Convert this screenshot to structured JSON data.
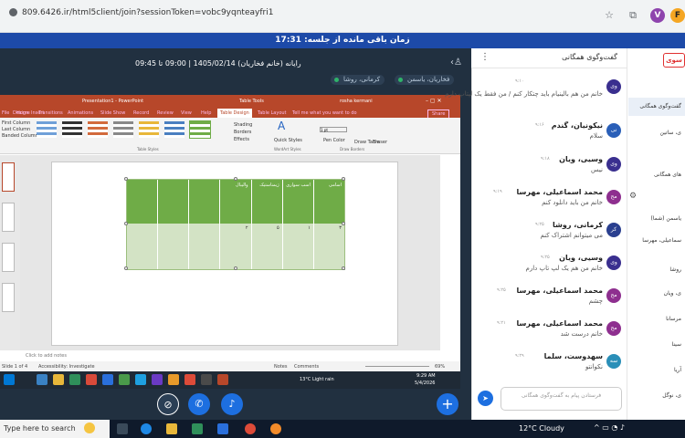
{
  "browser": {
    "url": "809.6426.ir/html5client/join?sessionToken=vobc9yqnteayfri1",
    "avatar_letter": "V"
  },
  "session": {
    "timer_text": "زمان باقی مانده از جلسه: 17:31"
  },
  "stage": {
    "title": "رایانه (خانم فخاریان) 1405/02/14 | 09:00 تا 09:45",
    "presenters": [
      "فخاریان، یاسمن",
      "کرمانی، روشا"
    ]
  },
  "powerpoint": {
    "window_title": "Presentation1 - PowerPoint",
    "context_tab": "Table Tools",
    "user": "rosha kermani",
    "tabs": [
      "File",
      "Home",
      "Insert",
      "Design",
      "Transitions",
      "Animations",
      "Slide Show",
      "Record",
      "Review",
      "View",
      "Help",
      "Table Design",
      "Table Layout",
      "Tell me what you want to do"
    ],
    "share_label": "Share",
    "left_options": [
      "First Column",
      "Last Column",
      "Banded Columns"
    ],
    "group_labels": [
      "Table Styles",
      "WordArt Styles",
      "Draw Borders"
    ],
    "ribbon_buttons": [
      "Shading",
      "Borders",
      "Effects",
      "Quick Styles",
      "Pen Color",
      "Draw Table",
      "Eraser"
    ],
    "pen_weight": "1 pt",
    "table_headers": [
      "اسامی",
      "اسب سواری",
      "ژیمناستیک",
      "والیبال",
      "",
      "",
      ""
    ],
    "table_values": [
      "۳",
      "۱",
      "۵",
      "۲",
      "",
      "",
      ""
    ],
    "notes_placeholder": "Click to add notes",
    "status_left": "Slide 1 of 4",
    "status_accessibility": "Accessibility: Investigate",
    "status_notes": "Notes",
    "status_comments": "Comments",
    "zoom": "69%",
    "weather": "13°C  Light rain",
    "time": "9:29 AM",
    "date": "5/4/2026"
  },
  "chat": {
    "header": "گفت‌وگوی همگانی",
    "input_placeholder": "فرستادن پیام به گفت‌وگوی همگانی",
    "messages": [
      {
        "avatar": "وی",
        "name": "",
        "time": "۹:۱۰",
        "text": "خانم من هم بالینیام باید چتکار کنم / من فقط یک لپتاپ دارم"
      },
      {
        "avatar": "نی",
        "name": "نیکونیان، گندم",
        "time": "۹:۱۶",
        "text": "سلام"
      },
      {
        "avatar": "وی",
        "name": "وسیی، ویان",
        "time": "۹:۱۸",
        "text": "نیس"
      },
      {
        "avatar": "مح",
        "name": "محمد اسماعیلی، مهرسا",
        "time": "۹:۱۹",
        "text": "خانم من باید دانلود کنم"
      },
      {
        "avatar": "کر",
        "name": "کرمانی، روشا",
        "time": "۹:۲۵",
        "text": "می میتوانم اشتراک کنم"
      },
      {
        "avatar": "وی",
        "name": "وسیی، ویان",
        "time": "۹:۲۵",
        "text": "خانم من هم یک لپ تاپ دارم"
      },
      {
        "avatar": "مح",
        "name": "محمد اسماعیلی، مهرسا",
        "time": "۹:۲۵",
        "text": "چشم"
      },
      {
        "avatar": "مح",
        "name": "محمد اسماعیلی، مهرسا",
        "time": "۹:۲۱",
        "text": "خانم درست شد"
      },
      {
        "avatar": "سه",
        "name": "سهدوست، سلما",
        "time": "۹:۲۹",
        "text": "نکوانتو"
      }
    ]
  },
  "sidebar": {
    "logo": "سوی",
    "items": [
      "گفت‌وگوی همگانی",
      "ی، ساتین",
      "های همگانی",
      "یاسمن (شما)",
      "سماعیلی، مهرسا",
      "روشا",
      "ی، ویان",
      "مرسانا",
      "سینا",
      "آریا",
      "ی، نوگل"
    ]
  },
  "taskbar": {
    "search_placeholder": "Type here to search",
    "weather": "12°C  Cloudy"
  },
  "colors": {
    "timer_bar": "#1d4aa8",
    "powerpoint_red": "#b7472a",
    "table_header_green": "#6fac47",
    "table_body_green": "#d3e3c5"
  }
}
